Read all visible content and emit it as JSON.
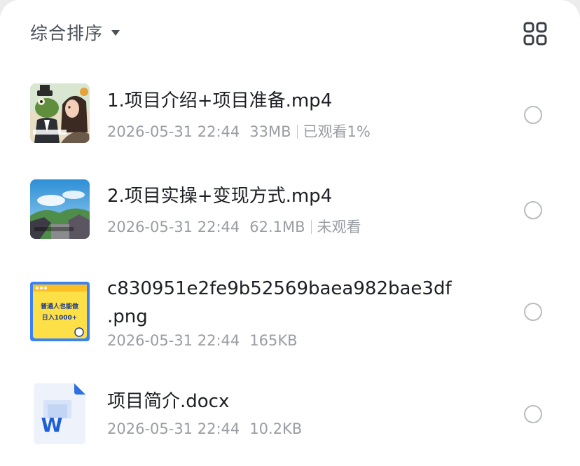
{
  "sort": {
    "label": "综合排序",
    "caret_icon": "caret-down-icon"
  },
  "view_toggle": {
    "icon": "grid-view-icon"
  },
  "files": [
    {
      "name": "1.项目介绍+项目准备.mp4",
      "date": "2026-05-31 22:44",
      "size": "33MB",
      "status": "已观看1%",
      "thumb": "video-thumbnail-cartoon"
    },
    {
      "name": "2.项目实操+变现方式.mp4",
      "date": "2026-05-31 22:44",
      "size": "62.1MB",
      "status": "未观看",
      "thumb": "video-thumbnail-landscape"
    },
    {
      "name_line1": "c830951e2fe9b52569baea982bae3df",
      "name_line2": ".png",
      "date": "2026-05-31 22:44",
      "size": "165KB",
      "thumb": "image-thumbnail-yellow",
      "thumb_text_line1": "普通人也能做",
      "thumb_text_line2": "日入1000+"
    },
    {
      "name": "项目简介.docx",
      "date": "2026-05-31 22:44",
      "size": "10.2KB",
      "thumb": "word-doc-icon",
      "doc_letter": "W"
    }
  ]
}
